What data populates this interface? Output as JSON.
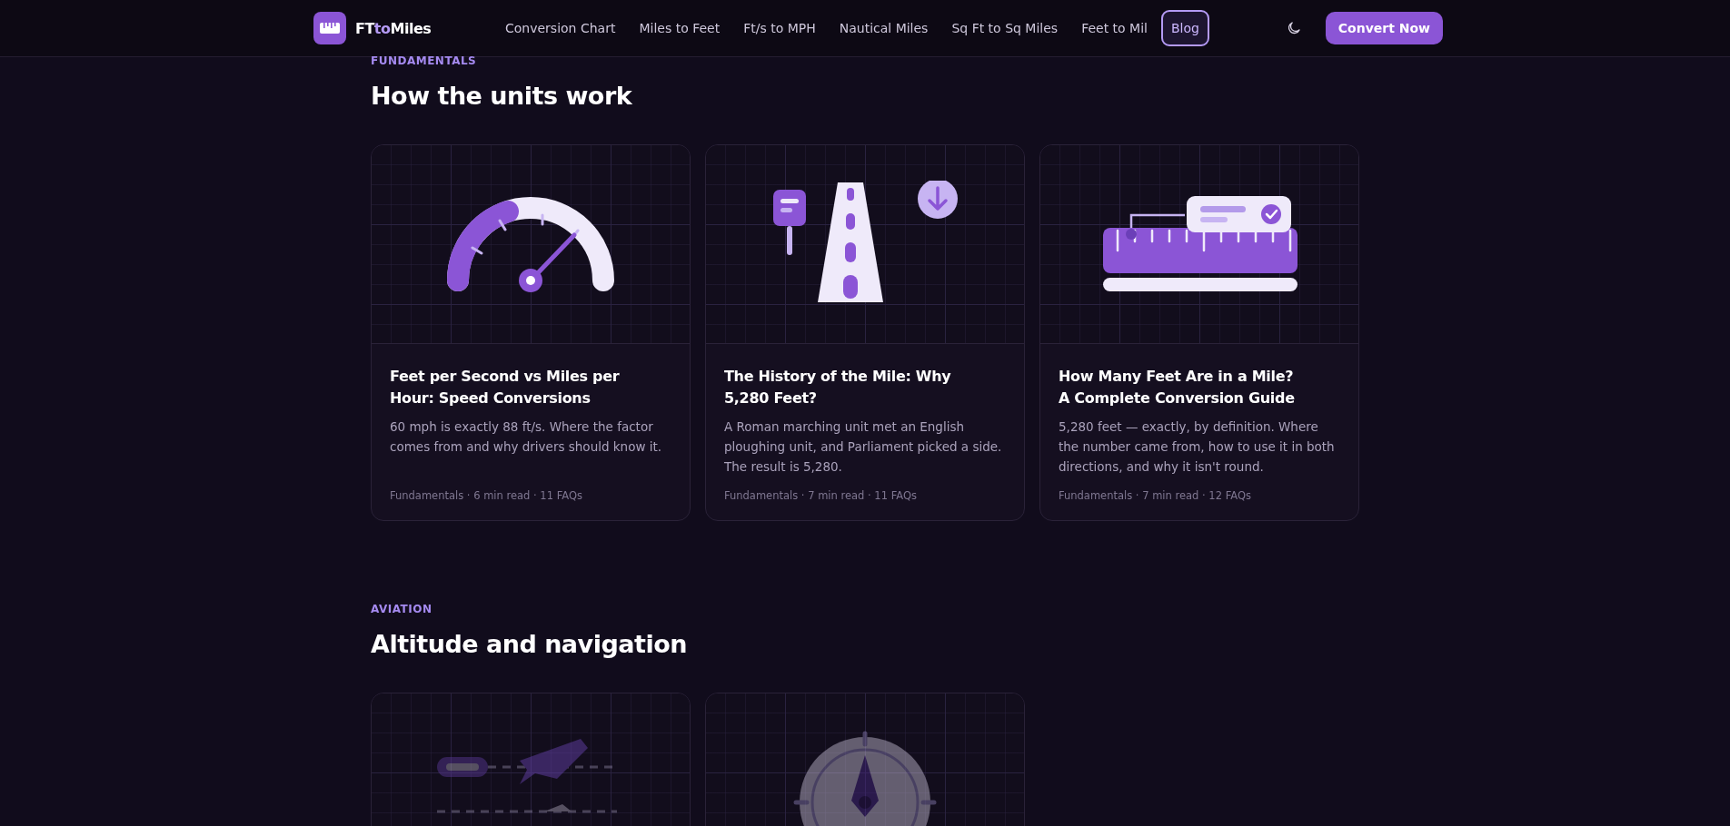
{
  "header": {
    "brand": [
      {
        "text": "FT",
        "accent": false
      },
      {
        "text": "to",
        "accent": true
      },
      {
        "text": "Miles",
        "accent": false
      }
    ],
    "nav": [
      {
        "label": "Conversion Chart",
        "selected": false
      },
      {
        "label": "Miles to Feet",
        "selected": false
      },
      {
        "label": "Ft/s to MPH",
        "selected": false
      },
      {
        "label": "Nautical Miles",
        "selected": false
      },
      {
        "label": "Sq Ft to Sq Miles",
        "selected": false
      },
      {
        "label": "Feet to Mil",
        "selected": false
      },
      {
        "label": "Blog",
        "selected": true
      }
    ],
    "cta": "Convert Now"
  },
  "sections": [
    {
      "eyebrow": "FUNDAMENTALS",
      "heading": "How the units work",
      "cards": [
        {
          "faded": false,
          "title": "Feet per Second vs Miles per Hour: Speed Conversions",
          "summary": "60 mph is exactly 88 ft/s. Where the factor comes from and why drivers should know it.",
          "meta": "Fundamentals · 6 min read · 11 FAQs"
        },
        {
          "faded": false,
          "title": "The History of the Mile: Why 5,280 Feet?",
          "summary": "A Roman marching unit met an English ploughing unit, and Parliament picked a side. The result is 5,280.",
          "meta": "Fundamentals · 7 min read · 11 FAQs"
        },
        {
          "faded": false,
          "title": "How Many Feet Are in a Mile? A Complete Conversion Guide",
          "summary": "5,280 feet — exactly, by definition. Where the number came from, how to use it in both directions, and why it isn't round.",
          "meta": "Fundamentals · 7 min read · 12 FAQs"
        }
      ]
    },
    {
      "eyebrow": "AVIATION",
      "heading": "Altitude and navigation",
      "cards": [
        {
          "faded": true
        },
        {
          "faded": true
        }
      ]
    }
  ]
}
